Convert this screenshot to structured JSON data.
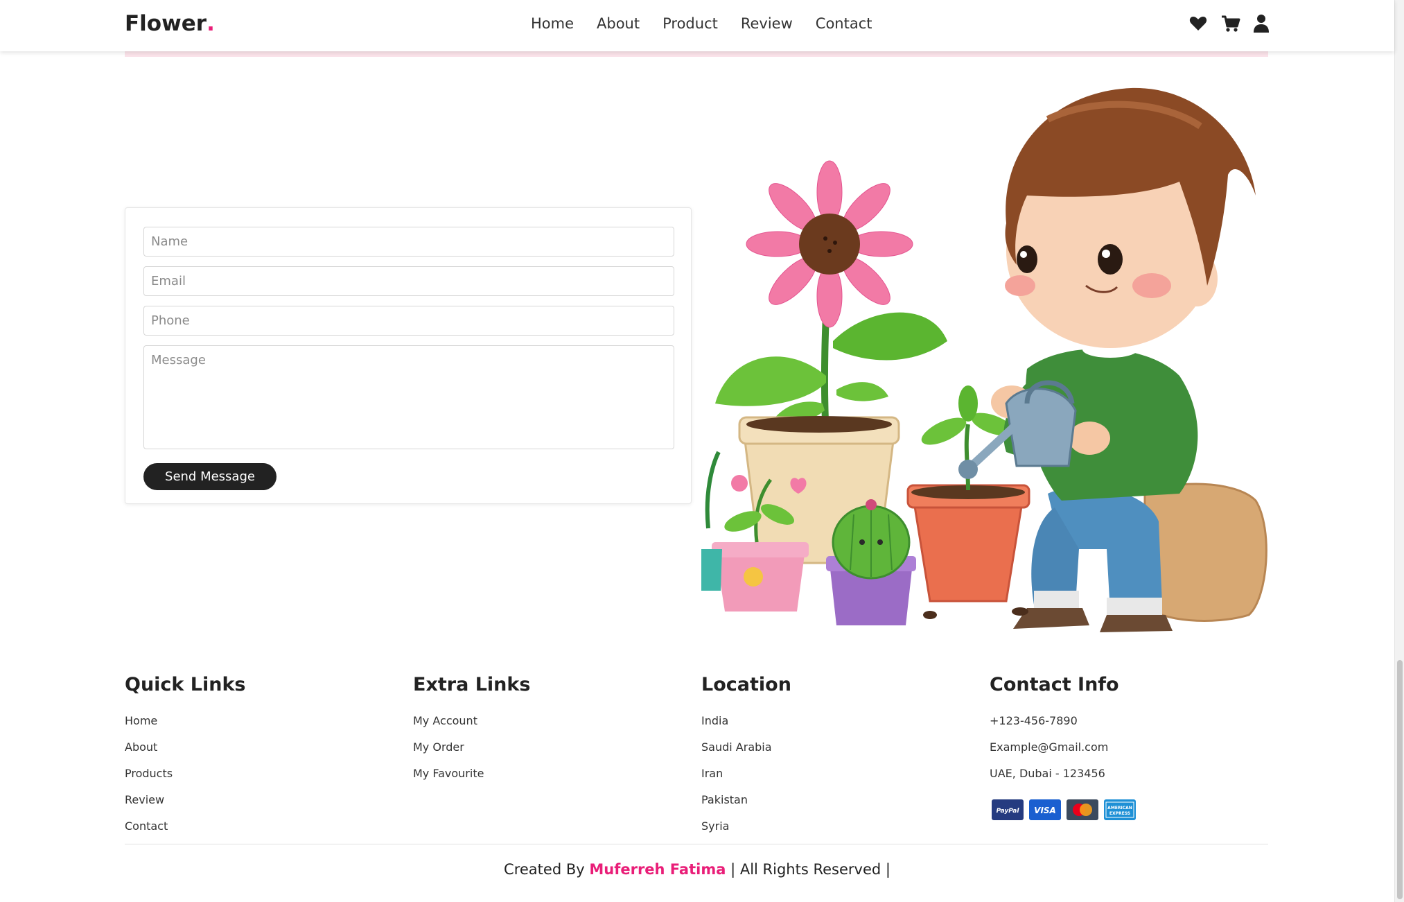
{
  "header": {
    "logo_text": "Flower",
    "logo_dot": ".",
    "nav": [
      "Home",
      "About",
      "Product",
      "Review",
      "Contact"
    ],
    "icons": [
      "heart-icon",
      "cart-icon",
      "user-icon"
    ]
  },
  "form": {
    "name_placeholder": "Name",
    "email_placeholder": "Email",
    "phone_placeholder": "Phone",
    "message_placeholder": "Message",
    "send_label": "Send Message"
  },
  "footer": {
    "quick_links": {
      "title": "Quick Links",
      "items": [
        "Home",
        "About",
        "Products",
        "Review",
        "Contact"
      ]
    },
    "extra_links": {
      "title": "Extra Links",
      "items": [
        "My Account",
        "My Order",
        "My Favourite"
      ]
    },
    "location": {
      "title": "Location",
      "items": [
        "India",
        "Saudi Arabia",
        "Iran",
        "Pakistan",
        "Syria"
      ]
    },
    "contact_info": {
      "title": "Contact Info",
      "items": [
        "+123-456-7890",
        "Example@Gmail.com",
        "UAE, Dubai - 123456"
      ],
      "payment_icons": [
        "paypal-icon",
        "visa-icon",
        "mastercard-icon",
        "american-express-icon"
      ]
    }
  },
  "credits": {
    "prefix": "Created By",
    "author": "Muferreh Fatima",
    "suffix": "| All Rights Reserved |"
  },
  "colors": {
    "accent": "#e91e78",
    "dark": "#222222",
    "pink_strip": "#fbe3ea"
  }
}
